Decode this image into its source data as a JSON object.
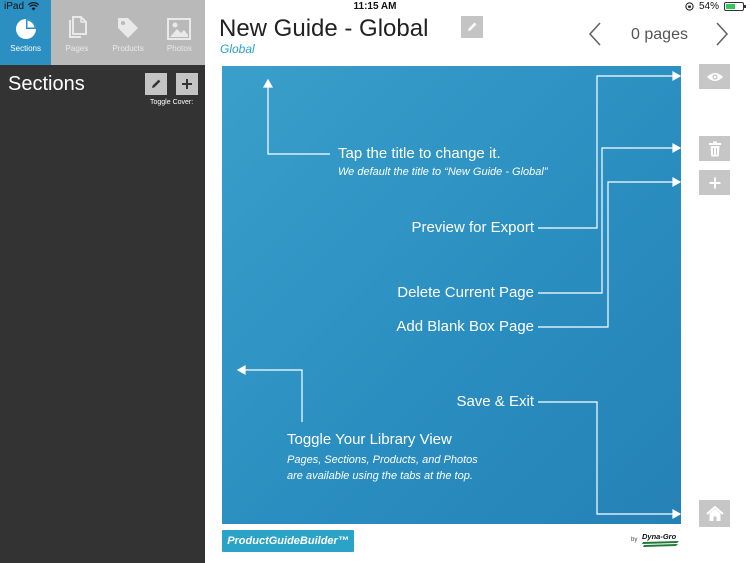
{
  "status_bar": {
    "device": "iPad",
    "time": "11:15 AM",
    "battery": "54%",
    "battery_level": 0.54
  },
  "sidebar": {
    "tabs": [
      {
        "label": "Sections",
        "icon": "pie-chart-icon",
        "active": true
      },
      {
        "label": "Pages",
        "icon": "pages-icon",
        "active": false
      },
      {
        "label": "Products",
        "icon": "tag-icon",
        "active": false
      },
      {
        "label": "Photos",
        "icon": "photo-icon",
        "active": false
      }
    ],
    "title": "Sections",
    "toggle_cover_label": "Toggle Cover:"
  },
  "header": {
    "title": "New Guide - Global",
    "subtitle": "Global",
    "page_count": "0 pages"
  },
  "canvas": {
    "annotations": {
      "title_tip": "Tap the title to change it.",
      "title_tip_sub": "We default the title to “New Guide - Global”",
      "preview": "Preview for Export",
      "delete": "Delete Current Page",
      "add_blank": "Add Blank Box Page",
      "save_exit": "Save & Exit",
      "toggle_library": "Toggle Your Library View",
      "toggle_library_sub1": "Pages, Sections, Products, and Photos",
      "toggle_library_sub2": "are available using the tabs at the top."
    },
    "background_color": "#2a8ec0"
  },
  "actions": {
    "preview_icon": "eye-icon",
    "delete_icon": "trash-icon",
    "add_icon": "plus-icon",
    "home_icon": "home-icon"
  },
  "footer": {
    "brand_logo": "ProductGuideBuilder™",
    "by_label": "by",
    "maker_logo": "Dyna-Gro"
  },
  "colors": {
    "accent": "#2aa3c7",
    "sidebar_bg": "#333333",
    "button_gray": "#c4c4c4"
  }
}
